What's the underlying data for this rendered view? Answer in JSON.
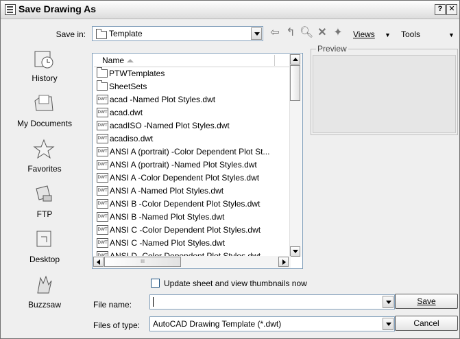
{
  "window": {
    "title": "Save Drawing As",
    "help_button": "?",
    "close_button": "✕"
  },
  "toolbar": {
    "save_in_label": "Save in:",
    "save_in_value": "Template",
    "views_label": "Views",
    "tools_label": "Tools"
  },
  "places": [
    {
      "label": "History",
      "icon": "history-icon"
    },
    {
      "label": "My Documents",
      "icon": "my-documents-icon"
    },
    {
      "label": "Favorites",
      "icon": "favorites-icon"
    },
    {
      "label": "FTP",
      "icon": "ftp-icon"
    },
    {
      "label": "Desktop",
      "icon": "desktop-icon"
    },
    {
      "label": "Buzzsaw",
      "icon": "buzzsaw-icon"
    }
  ],
  "file_list": {
    "column_header": "Name",
    "scroll_grip": "III",
    "items": [
      {
        "name": "PTWTemplates",
        "type": "folder"
      },
      {
        "name": "SheetSets",
        "type": "folder"
      },
      {
        "name": "acad -Named Plot Styles.dwt",
        "type": "dwt"
      },
      {
        "name": "acad.dwt",
        "type": "dwt"
      },
      {
        "name": "acadISO -Named Plot Styles.dwt",
        "type": "dwt"
      },
      {
        "name": "acadiso.dwt",
        "type": "dwt"
      },
      {
        "name": "ANSI A (portrait) -Color Dependent Plot St...",
        "type": "dwt"
      },
      {
        "name": "ANSI A (portrait) -Named Plot Styles.dwt",
        "type": "dwt"
      },
      {
        "name": "ANSI A -Color Dependent Plot Styles.dwt",
        "type": "dwt"
      },
      {
        "name": "ANSI A -Named Plot Styles.dwt",
        "type": "dwt"
      },
      {
        "name": "ANSI B -Color Dependent Plot Styles.dwt",
        "type": "dwt"
      },
      {
        "name": "ANSI B -Named Plot Styles.dwt",
        "type": "dwt"
      },
      {
        "name": "ANSI C -Color Dependent Plot Styles.dwt",
        "type": "dwt"
      },
      {
        "name": "ANSI C -Named Plot Styles.dwt",
        "type": "dwt"
      },
      {
        "name": "ANSI D -Color Dependent Plot Styles.dwt",
        "type": "dwt"
      }
    ],
    "dwt_icon_text": "DWT"
  },
  "preview": {
    "label": "Preview"
  },
  "thumbnail_option": {
    "label": "Update sheet and view thumbnails now",
    "checked": false
  },
  "file_name": {
    "label": "File name:",
    "value": ""
  },
  "file_type": {
    "label": "Files of type:",
    "value": "AutoCAD Drawing Template (*.dwt)"
  },
  "buttons": {
    "save": "Save",
    "cancel": "Cancel"
  }
}
